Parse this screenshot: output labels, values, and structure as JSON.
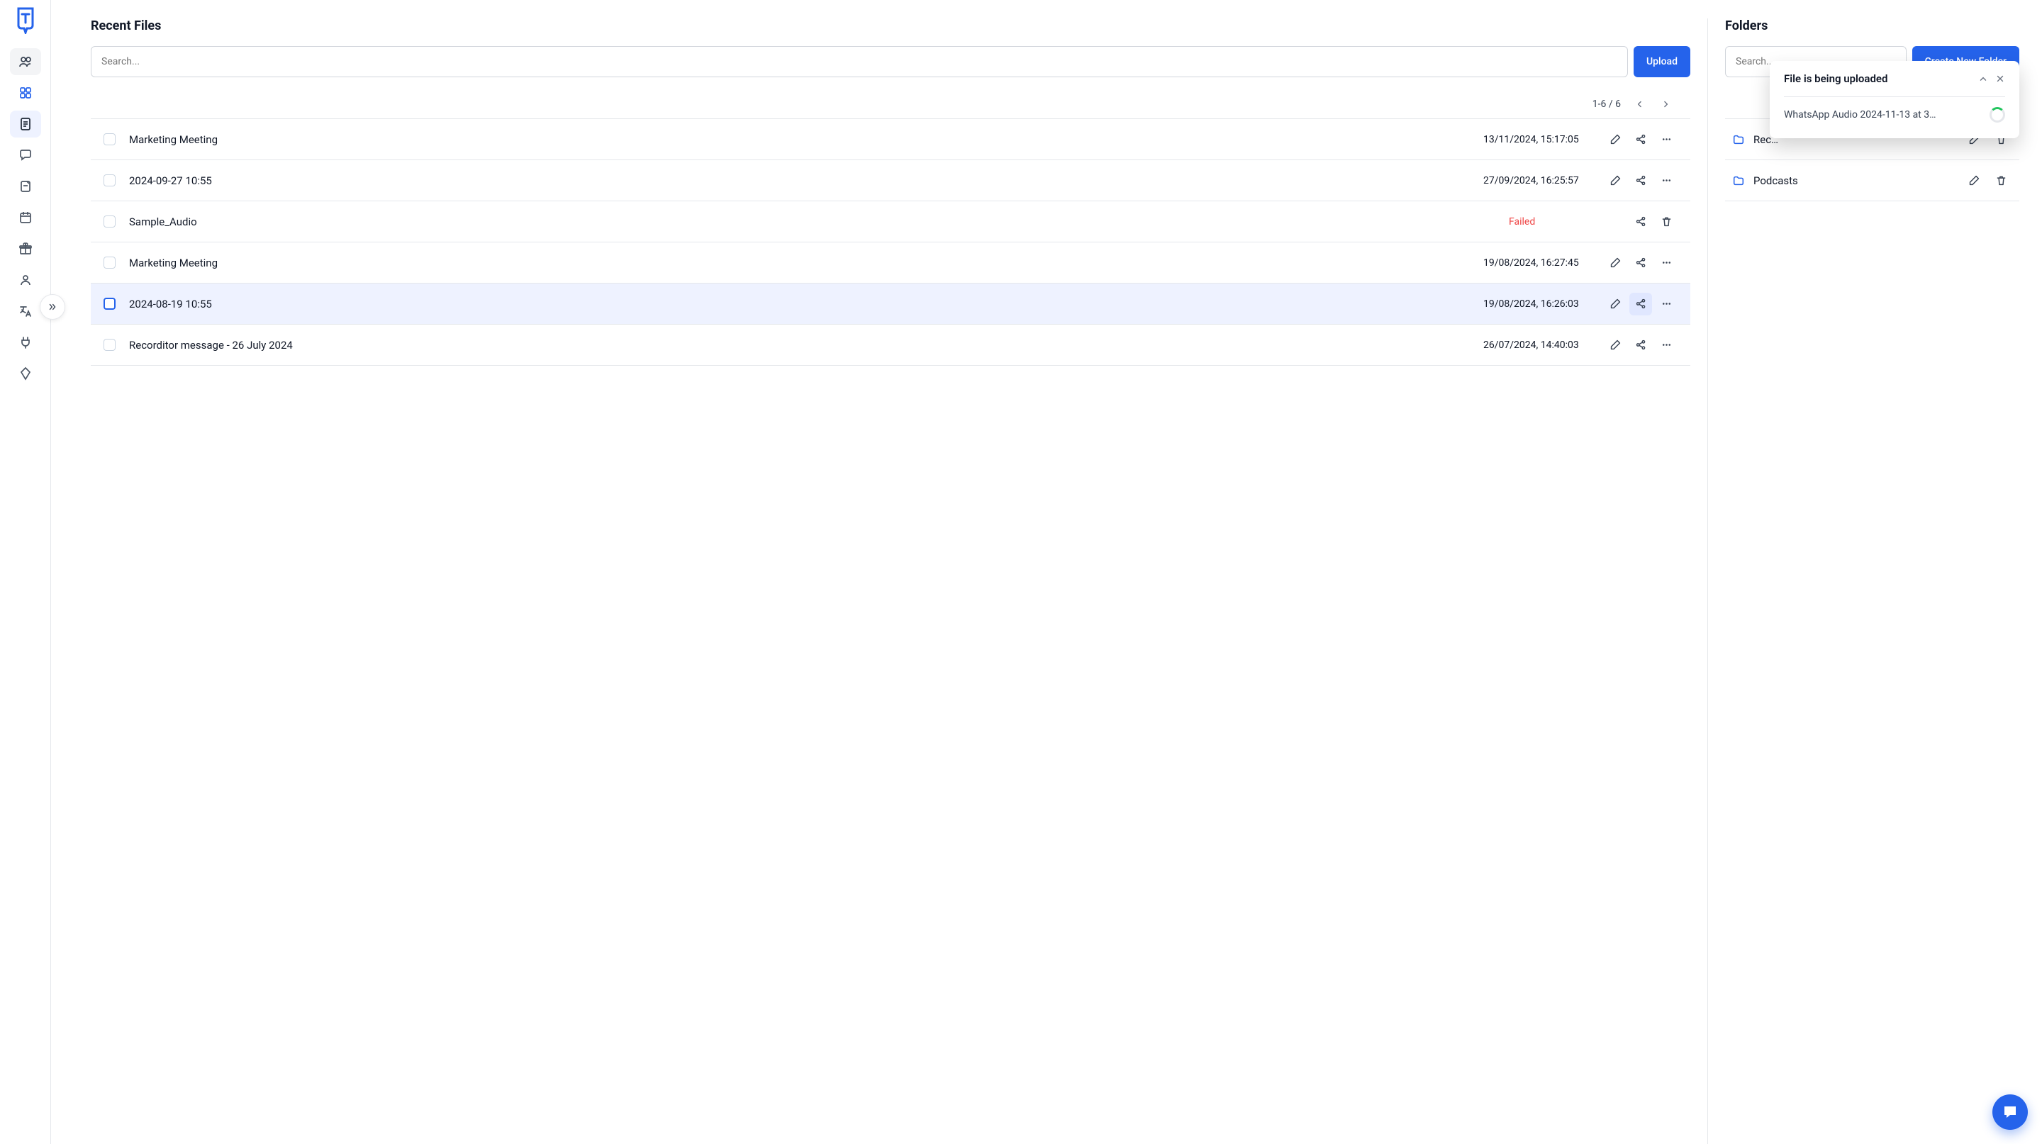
{
  "sidebar": {
    "items": [
      {
        "id": "people",
        "cls": "active-people"
      },
      {
        "id": "dashboard",
        "cls": "icon-blue"
      },
      {
        "id": "files",
        "cls": "active-doc"
      },
      {
        "id": "chat",
        "cls": ""
      },
      {
        "id": "notes",
        "cls": ""
      },
      {
        "id": "calendar",
        "cls": ""
      },
      {
        "id": "gifts",
        "cls": ""
      },
      {
        "id": "profile",
        "cls": ""
      },
      {
        "id": "translate",
        "cls": ""
      },
      {
        "id": "integrations",
        "cls": ""
      },
      {
        "id": "premium",
        "cls": ""
      }
    ]
  },
  "recent": {
    "title": "Recent Files",
    "search_placeholder": "Search...",
    "upload_label": "Upload",
    "pagination_text": "1-6 / 6",
    "rows": [
      {
        "name": "Marketing Meeting",
        "meta": "13/11/2024, 15:17:05",
        "status": "ok",
        "selected": false
      },
      {
        "name": "2024-09-27 10:55",
        "meta": "27/09/2024, 16:25:57",
        "status": "ok",
        "selected": false
      },
      {
        "name": "Sample_Audio",
        "meta": "Failed",
        "status": "failed",
        "selected": false
      },
      {
        "name": "Marketing Meeting",
        "meta": "19/08/2024, 16:27:45",
        "status": "ok",
        "selected": false
      },
      {
        "name": "2024-08-19 10:55",
        "meta": "19/08/2024, 16:26:03",
        "status": "ok",
        "selected": true
      },
      {
        "name": "Recorditor message - 26 July 2024",
        "meta": "26/07/2024, 14:40:03",
        "status": "ok",
        "selected": false
      }
    ]
  },
  "folders": {
    "title": "Folders",
    "search_placeholder": "Search...",
    "create_label": "Create New Folder",
    "rows": [
      {
        "name": "Rec…"
      },
      {
        "name": "Podcasts"
      }
    ]
  },
  "toast": {
    "title": "File is being uploaded",
    "file_name": "WhatsApp Audio 2024-11-13 at 3…"
  },
  "colors": {
    "primary": "#2563eb",
    "danger": "#ef4444",
    "success": "#22c55e"
  }
}
